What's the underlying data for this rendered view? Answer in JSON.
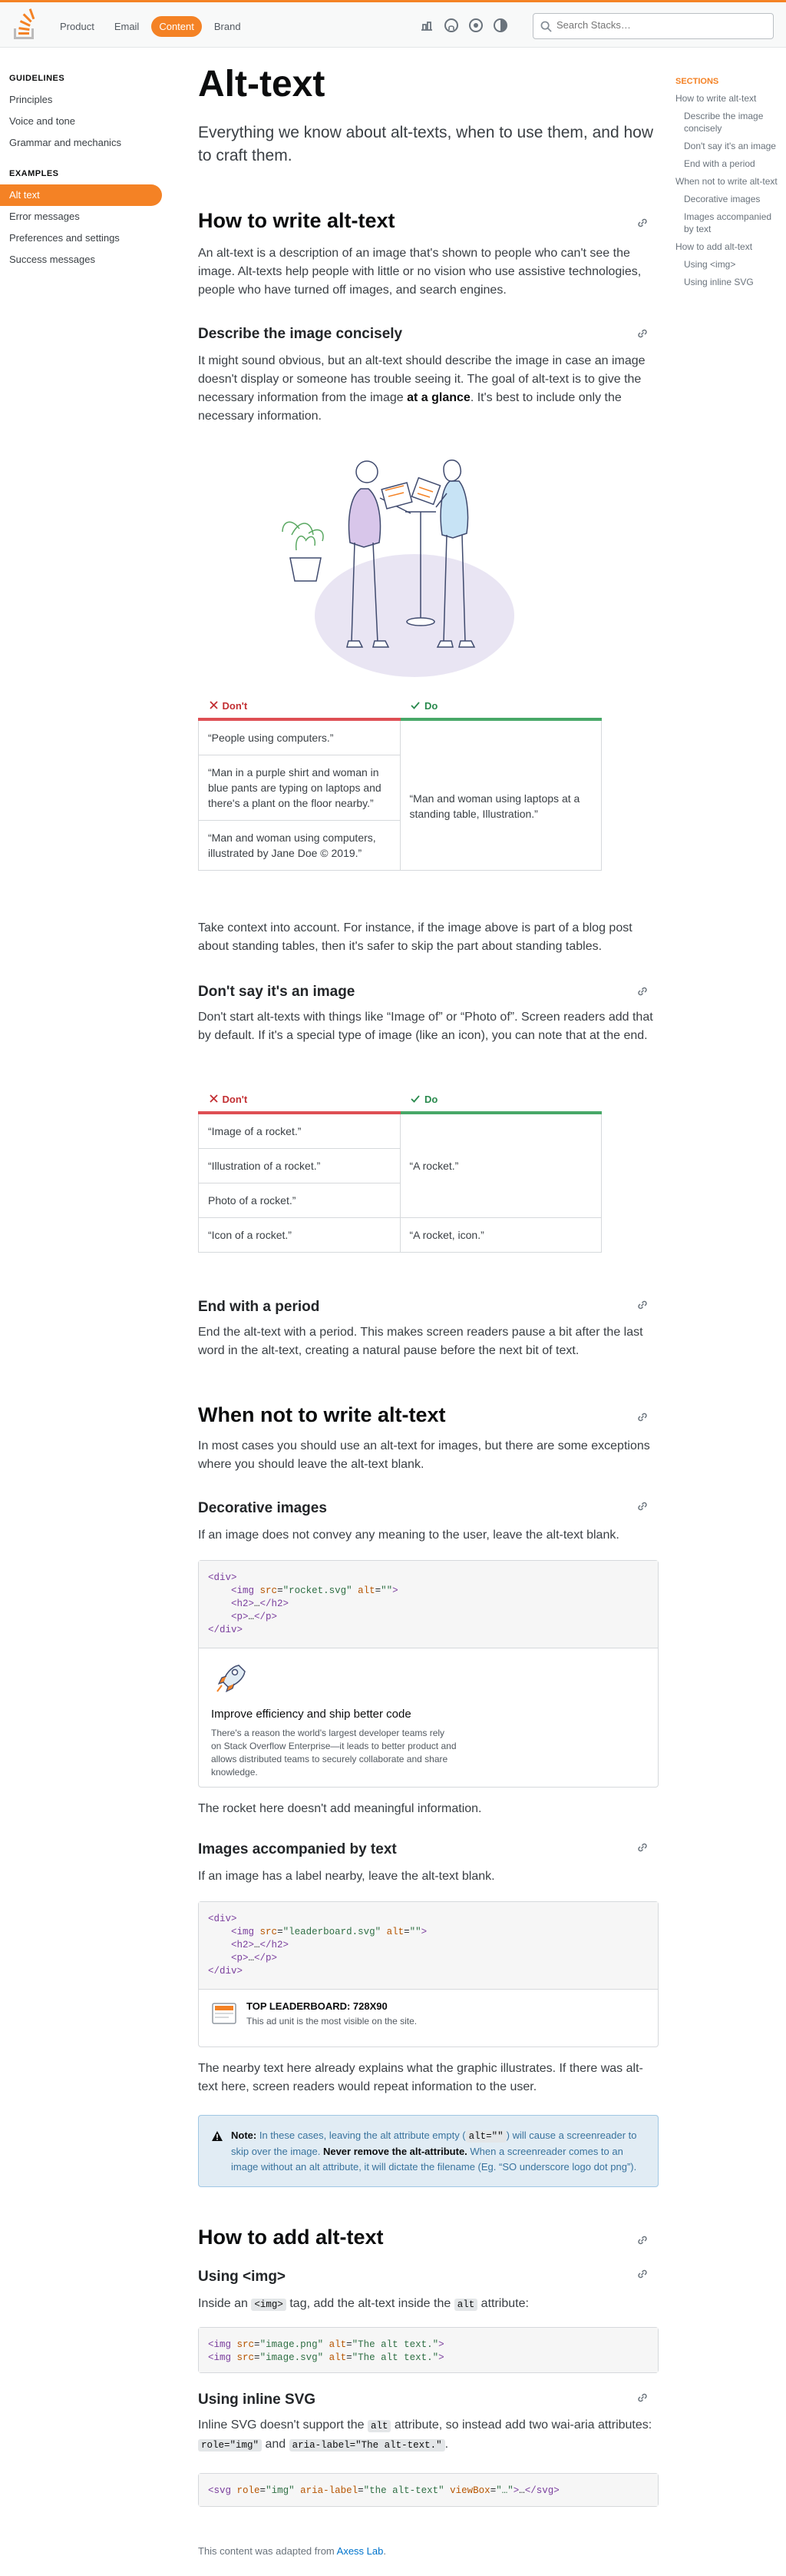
{
  "topbar": {
    "nav": [
      "Product",
      "Email",
      "Content",
      "Brand"
    ],
    "active_nav": "Content",
    "search_placeholder": "Search Stacks…"
  },
  "leftnav": {
    "sections": [
      {
        "title": "GUIDELINES",
        "items": [
          "Principles",
          "Voice and tone",
          "Grammar and mechanics"
        ]
      },
      {
        "title": "EXAMPLES",
        "items": [
          "Alt text",
          "Error messages",
          "Preferences and settings",
          "Success messages"
        ]
      }
    ],
    "active_item": "Alt text"
  },
  "page": {
    "title": "Alt-text",
    "lead": "Everything we know about alt-texts, when to use them, and how to craft them.",
    "how_title": "How to write alt-text",
    "how_body": "An alt-text is a description of an image that's shown to people who can't see the image. Alt-texts help people with little or no vision who use assistive technologies, people who have turned off images, and search engines.",
    "concise_title": "Describe the image concisely",
    "concise_body_a": "It might sound obvious, but an alt-text should describe the image in case an image doesn't display or someone has trouble seeing it. The goal of alt-text is to give the necessary information from the image ",
    "concise_body_bold": "at a glance",
    "concise_body_b": ". It's best to include only the necessary information.",
    "table1": {
      "dont_label": "Don't",
      "do_label": "Do",
      "dont": [
        "“People using computers.”",
        "“Man in a purple shirt and woman in blue pants are typing on laptops and there's a plant on the floor nearby.”",
        "“Man and woman using computers, illustrated by Jane Doe © 2019.”"
      ],
      "do": "“Man and woman using laptops at a standing table, Illustration.”"
    },
    "context_body": "Take context into account. For instance, if the image above is part of a blog post about standing tables, then it's safer to skip the part about standing tables.",
    "dont_say_title": "Don't say it's an image",
    "dont_say_body": "Don't start alt-texts with things like “Image of” or “Photo of”. Screen readers add that by default. If it's a special type of image (like an icon), you can note that at the end.",
    "table2": {
      "dont_label": "Don't",
      "do_label": "Do",
      "dont": [
        "“Image of a rocket.”",
        "“Illustration of a rocket.”",
        "Photo of a rocket.”",
        "“Icon of a rocket.”"
      ],
      "do": [
        "“A rocket.”",
        "“A rocket, icon.”"
      ]
    },
    "period_title": "End with a period",
    "period_body": "End the alt-text with a period. This makes screen readers pause a bit after the last word in the alt-text, creating a natural pause before the next bit of text.",
    "when_not_title": "When not to write alt-text",
    "when_not_body": "In most cases you should use an alt-text for images, but there are some exceptions where you should leave the alt-text blank.",
    "decorative_title": "Decorative images",
    "decorative_body": "If an image does not convey any meaning to the user, leave the alt-text blank.",
    "decorative_example": {
      "title": "Improve efficiency and ship better code",
      "body": "There's a reason the world's largest developer teams rely on Stack Overflow Enterprise—it leads to better product and allows distributed teams to securely collaborate and share knowledge."
    },
    "rocket_note": "The rocket here doesn't add meaningful information.",
    "accompanied_title": "Images accompanied by text",
    "accompanied_body": "If an image has a label nearby, leave the alt-text blank.",
    "leaderboard_example": {
      "title": "TOP LEADERBOARD: 728X90",
      "body": "This ad unit is the most visible on the site."
    },
    "nearby_body": "The nearby text here already explains what the graphic illustrates. If there was alt-text here, screen readers would repeat information to the user.",
    "note": {
      "label": "Note:",
      "a": " In these cases, leaving the alt attribute empty (",
      "code": "alt=\"\"",
      "b": ") will cause a screenreader to skip over the image. ",
      "bold": "Never remove the alt-attribute.",
      "c": " When a screenreader comes to an image without an alt attribute, it will dictate the filename (Eg. “SO underscore logo dot png”)."
    },
    "add_title": "How to add alt-text",
    "img_title": "Using <img>",
    "img_body_a": "Inside an ",
    "img_code": "<img>",
    "img_body_b": " tag, add the alt-text inside the ",
    "img_code2": "alt",
    "img_body_c": " attribute:",
    "svg_title": "Using inline SVG",
    "svg_body_a": "Inline SVG doesn't support the ",
    "svg_code1": "alt",
    "svg_body_b": " attribute, so instead add two wai-aria attributes: ",
    "svg_code2": "role=\"img\"",
    "svg_body_c": " and ",
    "svg_code3": "aria-label=\"The alt-text.\"",
    "svg_body_d": ".",
    "footer_a": "This content was adapted from ",
    "footer_link": "Axess Lab",
    "footer_b": "."
  },
  "sections": {
    "title": "SECTIONS",
    "links": [
      {
        "label": "How to write alt-text",
        "sub": false
      },
      {
        "label": "Describe the image concisely",
        "sub": true
      },
      {
        "label": "Don't say it's an image",
        "sub": true
      },
      {
        "label": "End with a period",
        "sub": true
      },
      {
        "label": "When not to write alt-text",
        "sub": false
      },
      {
        "label": "Decorative images",
        "sub": true
      },
      {
        "label": "Images accompanied by text",
        "sub": true
      },
      {
        "label": "How to add alt-text",
        "sub": false
      },
      {
        "label": "Using <img>",
        "sub": true
      },
      {
        "label": "Using inline SVG",
        "sub": true
      }
    ]
  },
  "colors": {
    "accent": "#f48225",
    "dont": "#de4f54",
    "do": "#48a868",
    "link": "#0074cc"
  }
}
